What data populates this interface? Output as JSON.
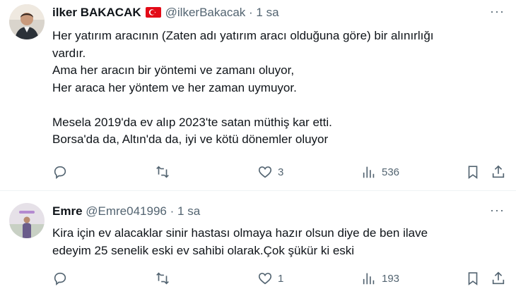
{
  "tweets": [
    {
      "author": "ilker BAKACAK",
      "handle": "@ilkerBakacak",
      "separator": "·",
      "time": "1 sa",
      "more": "···",
      "lines": [
        "Her yatırım aracının (Zaten adı yatırım aracı olduğuna göre) bir alınırlığı",
        "vardır.",
        "Ama her aracın bir yöntemi ve zamanı oluyor,",
        "Her araca her yöntem ve her zaman uymuyor.",
        "",
        "Mesela 2019'da ev alıp 2023'te satan müthiş kar etti.",
        "Borsa'da da, Altın'da da, iyi ve kötü dönemler oluyor"
      ],
      "replies": "",
      "reposts": "",
      "likes": "3",
      "views": "536"
    },
    {
      "author": "Emre",
      "handle": "@Emre041996",
      "separator": "·",
      "time": "1 sa",
      "more": "···",
      "lines": [
        "Kira için ev alacaklar sinir hastası olmaya hazır olsun diye de ben ilave",
        "edeyim 25 senelik eski ev sahibi olarak.Çok şükür ki eski"
      ],
      "replies": "",
      "reposts": "",
      "likes": "1",
      "views": "193"
    }
  ],
  "colors": {
    "text": "#0f1419",
    "muted": "#536471",
    "divider": "#eff3f4",
    "flag": "#e30a17"
  },
  "icons": [
    "reply-icon",
    "repost-icon",
    "like-icon",
    "views-icon",
    "bookmark-icon",
    "share-icon",
    "turkey-flag-icon",
    "more-icon"
  ]
}
